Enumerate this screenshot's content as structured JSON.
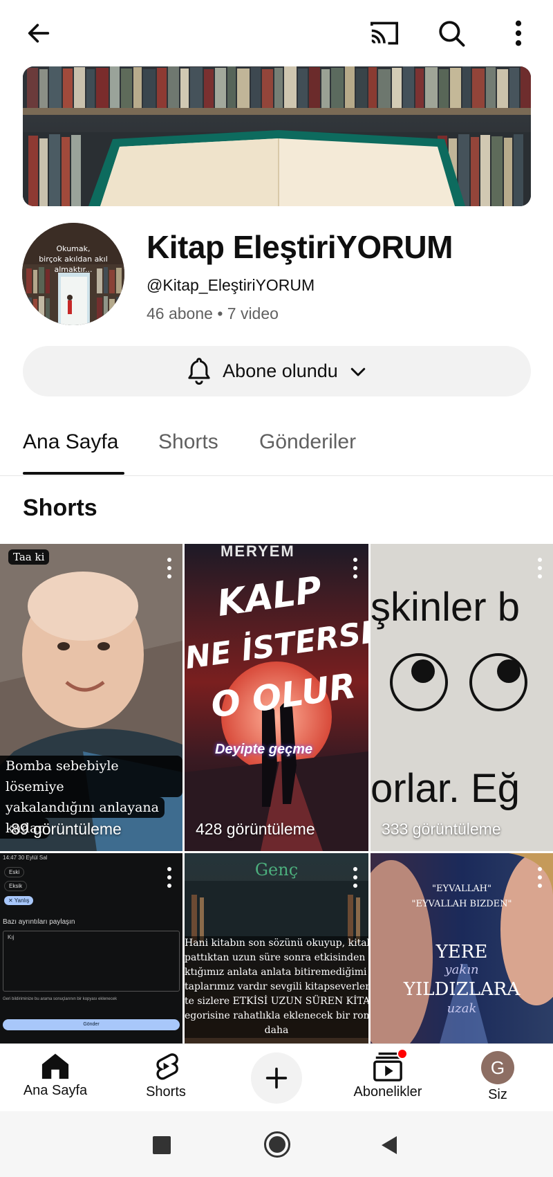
{
  "channel": {
    "name": "Kitap EleştiriYORUM",
    "handle": "@Kitap_EleştiriYORUM",
    "stats": "46 abone • 7 video",
    "avatar_quote_line1": "Okumak,",
    "avatar_quote_line2": "birçok akıldan akıl almaktır..."
  },
  "subscribe": {
    "label": "Abone olundu"
  },
  "tabs": [
    {
      "label": "Ana Sayfa",
      "active": true
    },
    {
      "label": "Shorts",
      "active": false
    },
    {
      "label": "Gönderiler",
      "active": false
    }
  ],
  "section": {
    "title": "Shorts"
  },
  "shorts": [
    {
      "badge": "Taa ki",
      "caption": [
        "Bomba sebebiyle lösemiye",
        "yakalandığını anlayana",
        "kadar"
      ],
      "views": "89 görüntüleme"
    },
    {
      "top_text": "MERYEM",
      "title_lines": [
        "KALP",
        "NE İSTERSE",
        "O OLUR"
      ],
      "sub": "Deyipte geçme",
      "views": "428 görüntüleme"
    },
    {
      "line1": "şkinler b",
      "line2": "orlar. Eğ",
      "views": "333 görüntüleme"
    },
    {
      "status": "14:47  30 Eylül Sal",
      "chips": [
        "Eski",
        "Eksik",
        "Yanlış"
      ],
      "form_label": "Bazı ayrıntıları paylaşın",
      "input_value": "Kıj",
      "note": "Geri bildiriminize bu arama sonuçlarının bir kopyası eklenecek",
      "button": "Gönder"
    },
    {
      "heading": "Genç",
      "lines": [
        "Hani kitabın son sözünü okuyup, kitab",
        "pattıktan uzun süre sonra etkisinden z",
        "ktığımız anlata anlata bitiremediğimi",
        "taplarımız vardır sevgili kitapseverler",
        "te sizlere ETKİSİ UZUN SÜREN KİTABL",
        "egorisine rahatlıkla eklenecek bir rom",
        "daha"
      ]
    },
    {
      "quote1": "\"EYVALLAH\"",
      "quote2": "\"EYVALLAH BIZDEN\"",
      "title1": "YERE",
      "title_script1": "yakın",
      "title2": "YILDIZLARA",
      "title_script2": "uzak"
    }
  ],
  "bottom_nav": [
    {
      "label": "Ana Sayfa",
      "icon": "home-icon"
    },
    {
      "label": "Shorts",
      "icon": "shorts-icon"
    },
    {
      "label": "",
      "icon": "create-icon"
    },
    {
      "label": "Abonelikler",
      "icon": "subscriptions-icon"
    },
    {
      "label": "Siz",
      "icon": "avatar",
      "avatar_letter": "G"
    }
  ],
  "colors": {
    "accent": "#0f0f0f",
    "muted": "#606060",
    "notification": "#ff0000",
    "avatar_bg": "#8d6e63"
  }
}
